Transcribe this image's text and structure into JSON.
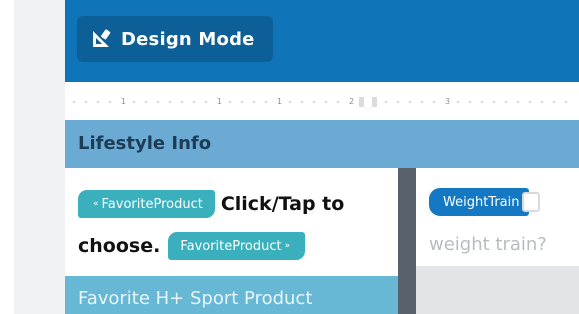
{
  "header": {
    "design_mode_label": "Design Mode",
    "design_mode_icon": "ruler-square-icon",
    "background_color": "#0f75b8"
  },
  "ruler": {
    "numbers": [
      "1",
      "1",
      "1",
      "2",
      "3"
    ]
  },
  "section": {
    "title": "Lifestyle Info"
  },
  "left_column": {
    "row1_pill": {
      "arrow": "«",
      "label": "FavoriteProduct"
    },
    "row1_text": "Click/Tap to",
    "row2_text": "choose.",
    "row2_pill": {
      "label": "FavoriteProduct",
      "arrow": "»"
    },
    "field_label": "Favorite H+ Sport Product"
  },
  "right_column": {
    "pill_label": "WeightTrain",
    "question_text": "weight train?"
  },
  "colors": {
    "accent_blue": "#0f75b8",
    "pill_teal": "#3ab0bd",
    "pill_blue": "#1578c2",
    "section_bar": "#6aaad3"
  }
}
